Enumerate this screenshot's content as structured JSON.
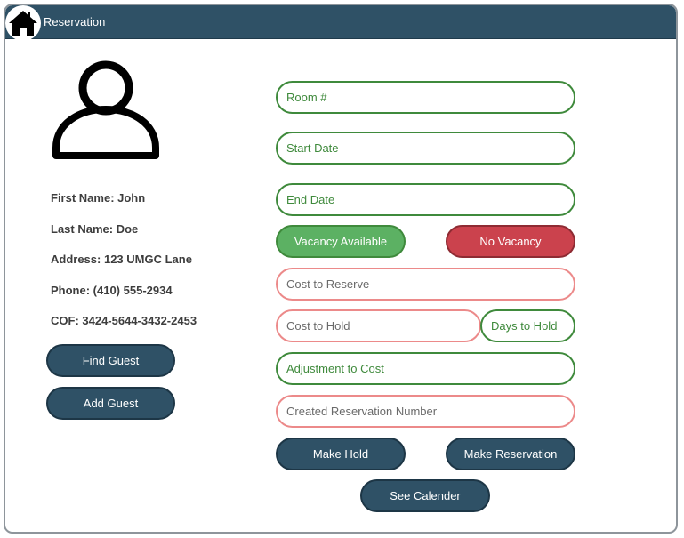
{
  "window": {
    "title": "Reservation",
    "home_icon": "home-icon"
  },
  "guest": {
    "avatar_icon": "user-icon",
    "first_name": "First Name: John",
    "last_name": "Last Name: Doe",
    "address": "Address: 123 UMGC Lane",
    "phone": "Phone: (410) 555-2934",
    "cof": "COF: 3424-5644-3432-2453"
  },
  "guest_actions": {
    "find_guest": "Find Guest",
    "add_guest": "Add Guest"
  },
  "reservation": {
    "room": "Room #",
    "start_date": "Start Date",
    "end_date": "End Date",
    "vacancy_available": "Vacancy Available",
    "no_vacancy": "No Vacancy",
    "cost_to_reserve": "Cost to Reserve",
    "cost_to_hold": "Cost to Hold",
    "days_to_hold": "Days to Hold",
    "adjustment_to_cost": "Adjustment to Cost",
    "created_reservation_number": "Created Reservation Number"
  },
  "actions": {
    "make_hold": "Make Hold",
    "make_reservation": "Make Reservation",
    "see_calender": "See Calender"
  },
  "colors": {
    "titlebar": "#2f5166",
    "button": "#2f5166",
    "green_border": "#3f8a3c",
    "red_border": "#ec8a8a",
    "vacancy_fill": "#5cb163",
    "no_vacancy_fill": "#cb424d"
  }
}
